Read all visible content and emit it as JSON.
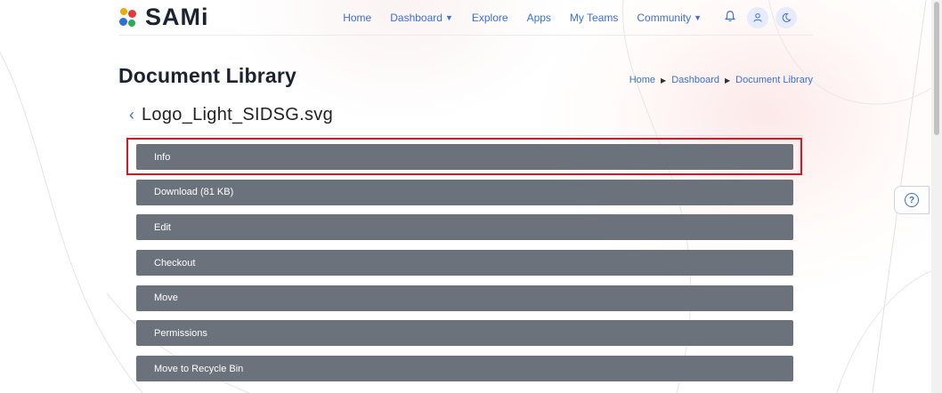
{
  "header": {
    "logo_text": "SAMi",
    "nav": [
      {
        "label": "Home",
        "has_caret": false
      },
      {
        "label": "Dashboard",
        "has_caret": true
      },
      {
        "label": "Explore",
        "has_caret": false
      },
      {
        "label": "Apps",
        "has_caret": false
      },
      {
        "label": "My Teams",
        "has_caret": false
      },
      {
        "label": "Community",
        "has_caret": true
      }
    ],
    "icons": [
      "bell-icon",
      "user-icon",
      "moon-icon"
    ]
  },
  "page": {
    "title": "Document Library",
    "breadcrumb": [
      "Home",
      "Dashboard",
      "Document Library"
    ],
    "file_name": "Logo_Light_SIDSG.svg"
  },
  "actions": [
    "Info",
    "Download (81 KB)",
    "Edit",
    "Checkout",
    "Move",
    "Permissions",
    "Move to Recycle Bin"
  ],
  "colors": {
    "accent": "#3a6fd8",
    "button_bg": "#6b727b",
    "highlight": "#e0141e"
  }
}
